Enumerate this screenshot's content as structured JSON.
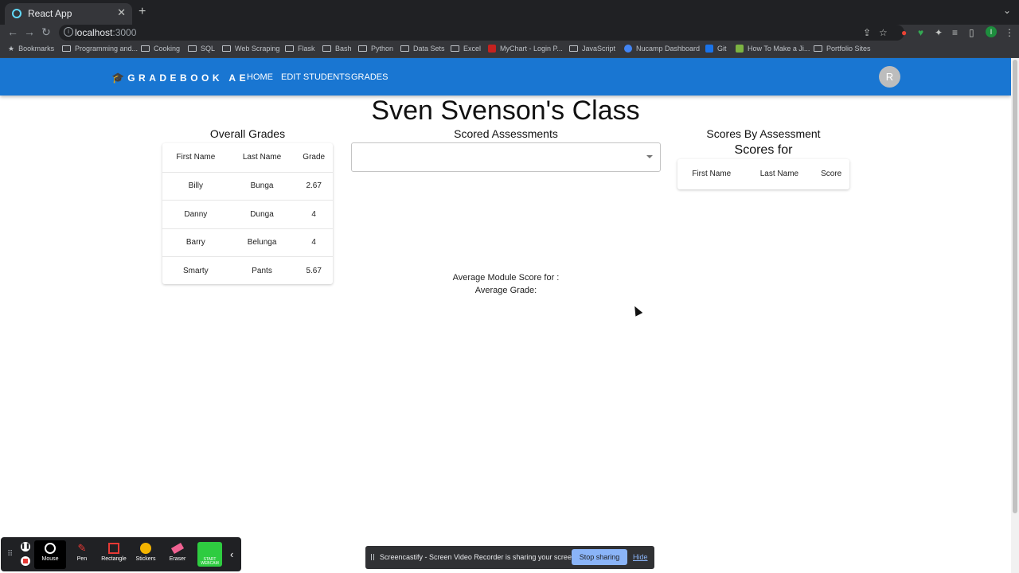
{
  "browser": {
    "tab_title": "React App",
    "url_host": "localhost",
    "url_port": ":3000",
    "bookmarks": [
      "Bookmarks",
      "Programming and...",
      "Cooking",
      "SQL",
      "Web Scraping",
      "Flask",
      "Bash",
      "Python",
      "Data Sets",
      "Excel",
      "MyChart - Login P...",
      "JavaScript",
      "Nucamp Dashboard",
      "Git",
      "How To Make a Ji...",
      "Portfolio Sites"
    ],
    "profile_initial": "I"
  },
  "appbar": {
    "brand": "GRADEBOOK AE",
    "nav": [
      "HOME",
      "EDIT STUDENTS",
      "GRADES"
    ],
    "avatar_initial": "R",
    "color": "#1976d2"
  },
  "page": {
    "title": "Sven Svenson's Class",
    "overall": {
      "title": "Overall Grades",
      "columns": [
        "First Name",
        "Last Name",
        "Grade"
      ],
      "rows": [
        [
          "Billy",
          "Bunga",
          "2.67"
        ],
        [
          "Danny",
          "Dunga",
          "4"
        ],
        [
          "Barry",
          "Belunga",
          "4"
        ],
        [
          "Smarty",
          "Pants",
          "5.67"
        ]
      ]
    },
    "scored": {
      "title": "Scored Assessments",
      "select_value": "",
      "avg_module": "Average Module Score for :",
      "avg_grade": "Average Grade:"
    },
    "by_assessment": {
      "title": "Scores By Assessment",
      "subtitle": "Scores for",
      "columns": [
        "First Name",
        "Last Name",
        "Score"
      ]
    }
  },
  "dock": {
    "items": [
      "Mouse",
      "Pen",
      "Rectangle",
      "Stickers",
      "Eraser"
    ],
    "webcam": "START WEBCAM"
  },
  "sharebar": {
    "message": "Screencastify - Screen Video Recorder is sharing your screen.",
    "stop": "Stop sharing",
    "hide": "Hide"
  }
}
